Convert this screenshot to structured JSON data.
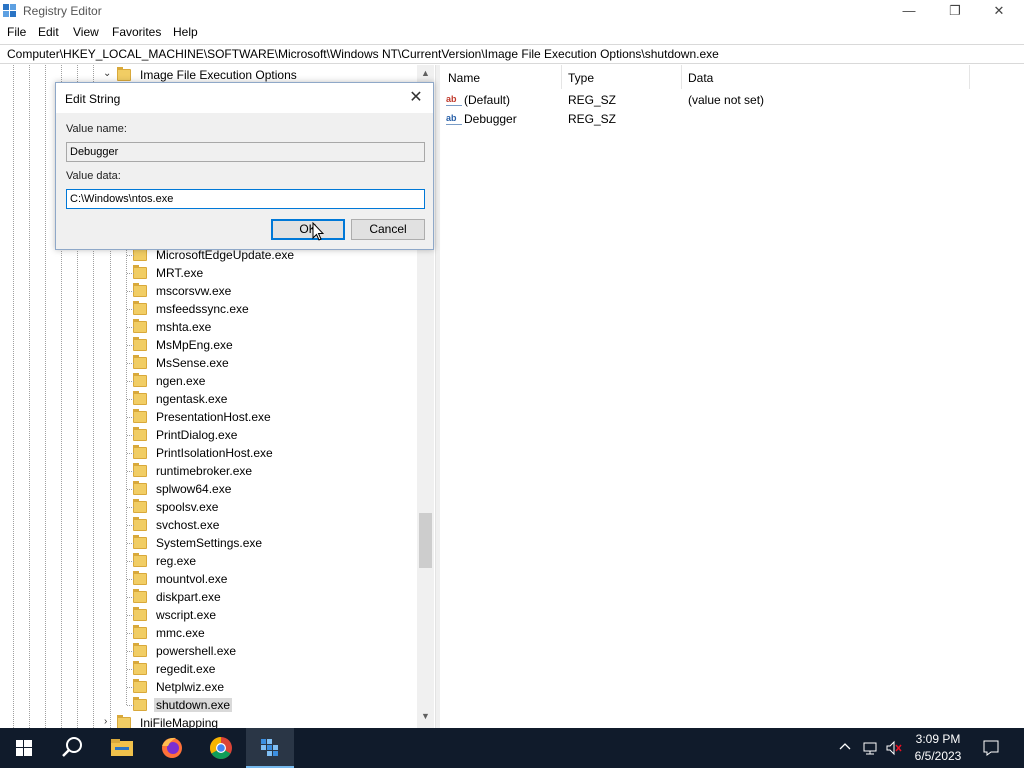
{
  "window": {
    "title": "Registry Editor",
    "controls": {
      "minimize": "—",
      "restore": "❐",
      "close": "✕"
    }
  },
  "menu": [
    "File",
    "Edit",
    "View",
    "Favorites",
    "Help"
  ],
  "address": "Computer\\HKEY_LOCAL_MACHINE\\SOFTWARE\\Microsoft\\Windows NT\\CurrentVersion\\Image File Execution Options\\shutdown.exe",
  "tree": {
    "parent": "Image File Execution Options",
    "children": [
      "MicrosoftEdgeUpdate.exe",
      "MRT.exe",
      "mscorsvw.exe",
      "msfeedssync.exe",
      "mshta.exe",
      "MsMpEng.exe",
      "MsSense.exe",
      "ngen.exe",
      "ngentask.exe",
      "PresentationHost.exe",
      "PrintDialog.exe",
      "PrintIsolationHost.exe",
      "runtimebroker.exe",
      "splwow64.exe",
      "spoolsv.exe",
      "svchost.exe",
      "SystemSettings.exe",
      "reg.exe",
      "mountvol.exe",
      "diskpart.exe",
      "wscript.exe",
      "mmc.exe",
      "powershell.exe",
      "regedit.exe",
      "Netplwiz.exe",
      "shutdown.exe"
    ],
    "selected": "shutdown.exe",
    "next_sibling": "IniFileMapping"
  },
  "list": {
    "columns": [
      "Name",
      "Type",
      "Data"
    ],
    "rows": [
      {
        "name": "(Default)",
        "type": "REG_SZ",
        "data": "(value not set)",
        "icon": "ab"
      },
      {
        "name": "Debugger",
        "type": "REG_SZ",
        "data": "",
        "icon": "ab"
      }
    ]
  },
  "dialog": {
    "title": "Edit String",
    "value_name_label": "Value name:",
    "value_name": "Debugger",
    "value_data_label": "Value data:",
    "value_data": "C:\\Windows\\ntos.exe",
    "ok_label": "OK",
    "cancel_label": "Cancel",
    "close_glyph": "✕"
  },
  "taskbar": {
    "apps": [
      "start-icon",
      "search-icon",
      "file-explorer-icon",
      "firefox-icon",
      "chrome-icon",
      "registry-editor-icon"
    ],
    "active_app": "registry-editor-icon",
    "time": "3:09 PM",
    "date": "6/5/2023"
  },
  "colors": {
    "accent": "#0078d7",
    "folder": "#f1cd64",
    "taskbar": "#101b2b"
  }
}
